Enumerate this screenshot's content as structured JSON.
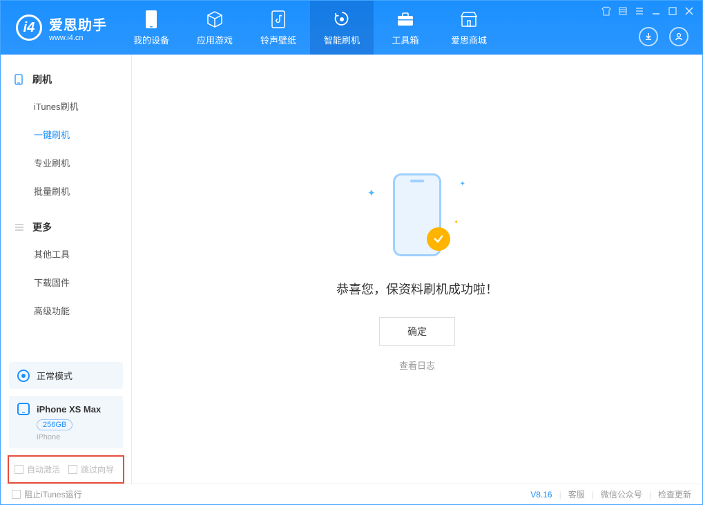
{
  "app": {
    "title": "爱思助手",
    "subtitle": "www.i4.cn"
  },
  "nav": {
    "tabs": [
      {
        "label": "我的设备"
      },
      {
        "label": "应用游戏"
      },
      {
        "label": "铃声壁纸"
      },
      {
        "label": "智能刷机"
      },
      {
        "label": "工具箱"
      },
      {
        "label": "爱思商城"
      }
    ]
  },
  "sidebar": {
    "section1": {
      "title": "刷机",
      "items": [
        "iTunes刷机",
        "一键刷机",
        "专业刷机",
        "批量刷机"
      ]
    },
    "section2": {
      "title": "更多",
      "items": [
        "其他工具",
        "下载固件",
        "高级功能"
      ]
    }
  },
  "device": {
    "mode": "正常模式",
    "name": "iPhone XS Max",
    "capacity": "256GB",
    "type": "iPhone"
  },
  "options": {
    "auto_activate": "自动激活",
    "skip_guide": "跳过向导"
  },
  "main": {
    "success_text": "恭喜您，保资料刷机成功啦！",
    "confirm": "确定",
    "view_log": "查看日志"
  },
  "footer": {
    "block_itunes": "阻止iTunes运行",
    "version": "V8.16",
    "support": "客服",
    "wechat": "微信公众号",
    "check_update": "检查更新"
  }
}
